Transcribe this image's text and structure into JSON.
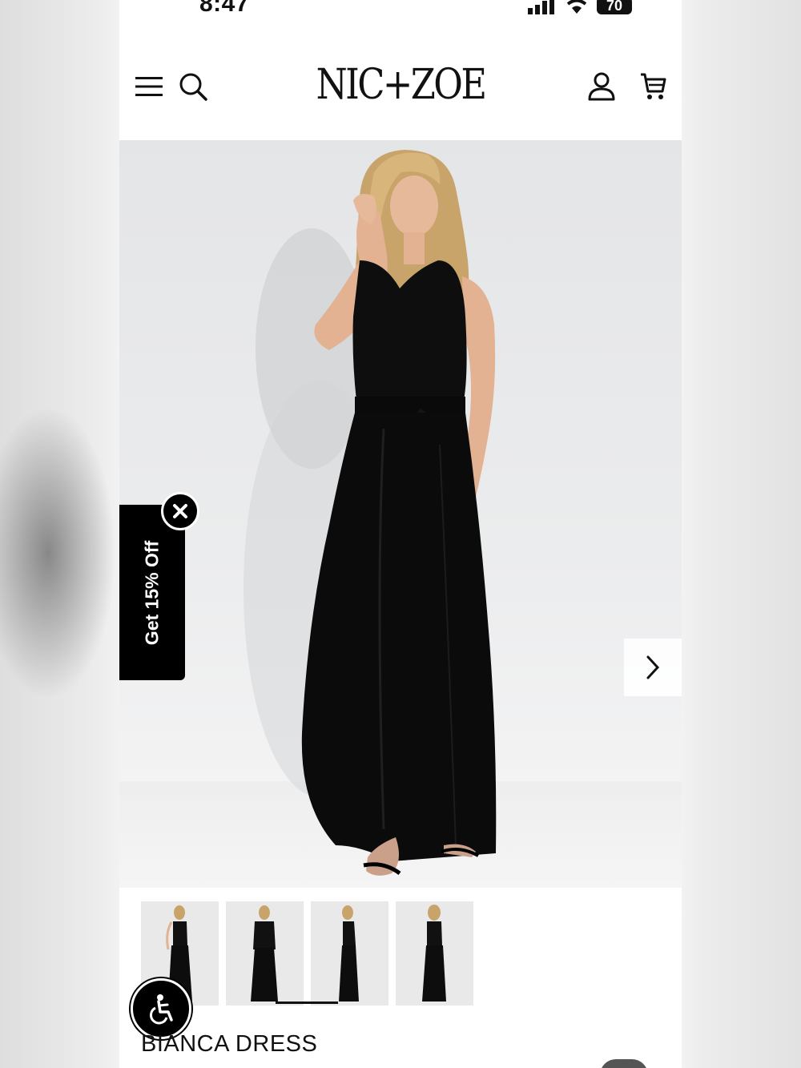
{
  "status_bar": {
    "time": "8:47",
    "battery": "70"
  },
  "header": {
    "logo": "NIC+ZOE",
    "menu_icon": "hamburger-menu-icon",
    "search_icon": "search-icon",
    "account_icon": "account-icon",
    "cart_icon": "cart-icon"
  },
  "promo": {
    "label": "Get 15% Off",
    "close_icon": "close-icon"
  },
  "carousel": {
    "next_icon": "chevron-right-icon",
    "thumbnail_count": 4
  },
  "accessibility": {
    "icon": "accessibility-icon"
  },
  "product": {
    "title": "BIANCA DRESS"
  },
  "colors": {
    "dress": "#0b0b0b",
    "promo_bg": "#000000",
    "page_bg": "#ffffff"
  }
}
